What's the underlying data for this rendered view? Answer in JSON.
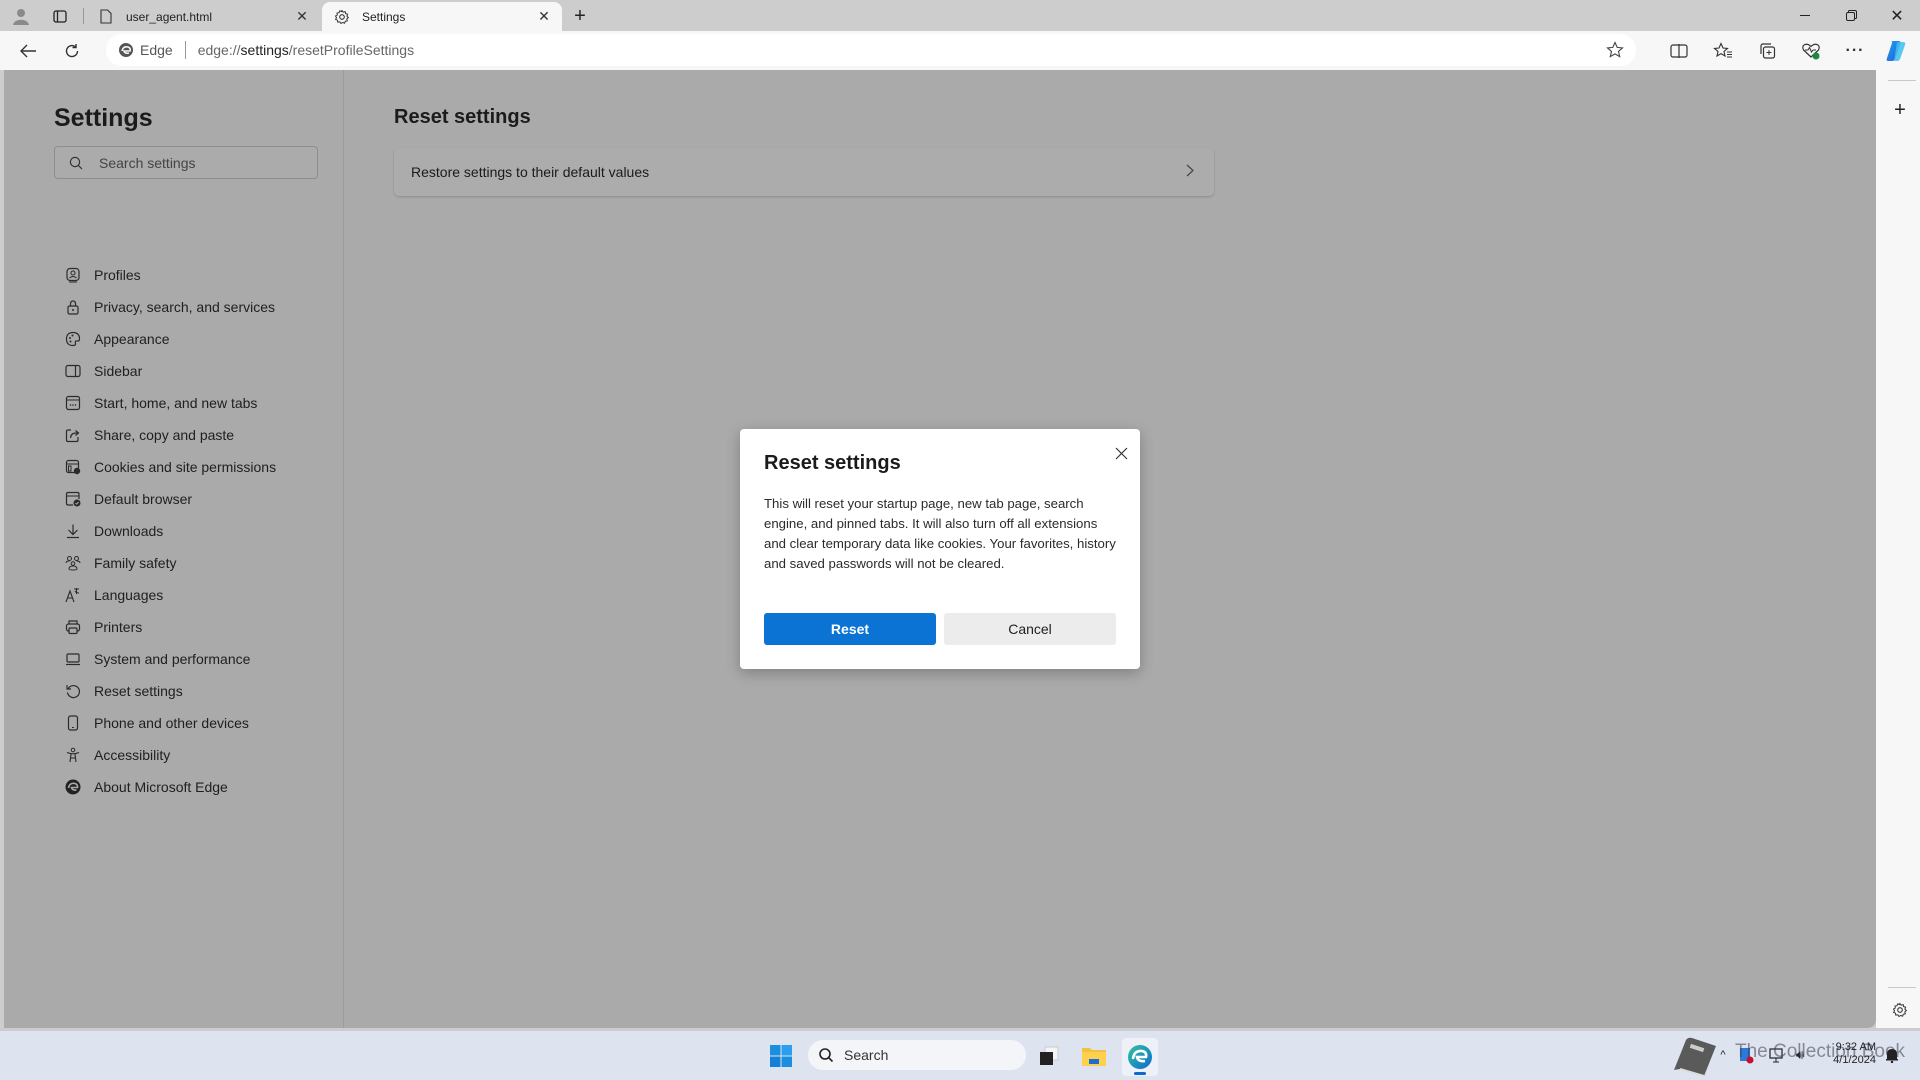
{
  "browser": {
    "tabs": [
      {
        "title": "user_agent.html",
        "icon": "file-icon",
        "active": false
      },
      {
        "title": "Settings",
        "icon": "gear-icon",
        "active": true
      }
    ],
    "address_bar": {
      "badge": "Edge",
      "url_prefix": "edge://",
      "url_host": "settings",
      "url_path": "/resetProfileSettings"
    }
  },
  "settings": {
    "title": "Settings",
    "search_placeholder": "Search settings",
    "nav_items": [
      {
        "label": "Profiles",
        "icon": "profile-icon"
      },
      {
        "label": "Privacy, search, and services",
        "icon": "lock-icon"
      },
      {
        "label": "Appearance",
        "icon": "palette-icon"
      },
      {
        "label": "Sidebar",
        "icon": "sidebar-icon"
      },
      {
        "label": "Start, home, and new tabs",
        "icon": "home-tabs-icon"
      },
      {
        "label": "Share, copy and paste",
        "icon": "share-icon"
      },
      {
        "label": "Cookies and site permissions",
        "icon": "cookies-icon"
      },
      {
        "label": "Default browser",
        "icon": "default-browser-icon"
      },
      {
        "label": "Downloads",
        "icon": "download-icon"
      },
      {
        "label": "Family safety",
        "icon": "family-icon"
      },
      {
        "label": "Languages",
        "icon": "languages-icon"
      },
      {
        "label": "Printers",
        "icon": "printer-icon"
      },
      {
        "label": "System and performance",
        "icon": "laptop-icon"
      },
      {
        "label": "Reset settings",
        "icon": "reset-icon"
      },
      {
        "label": "Phone and other devices",
        "icon": "phone-icon"
      },
      {
        "label": "Accessibility",
        "icon": "accessibility-icon"
      },
      {
        "label": "About Microsoft Edge",
        "icon": "edge-icon"
      }
    ],
    "main": {
      "title": "Reset settings",
      "card_label": "Restore settings to their default values"
    }
  },
  "dialog": {
    "title": "Reset settings",
    "body": "This will reset your startup page, new tab page, search engine, and pinned tabs. It will also turn off all extensions and clear temporary data like cookies. Your favorites, history and saved passwords will not be cleared.",
    "primary_button": "Reset",
    "secondary_button": "Cancel"
  },
  "taskbar": {
    "search_placeholder": "Search",
    "time": "9:32 AM",
    "date": "4/1/2024",
    "watermark": "The Collection Book"
  },
  "colors": {
    "accent": "#0a73d3",
    "overlay": "#aaaaaa"
  }
}
